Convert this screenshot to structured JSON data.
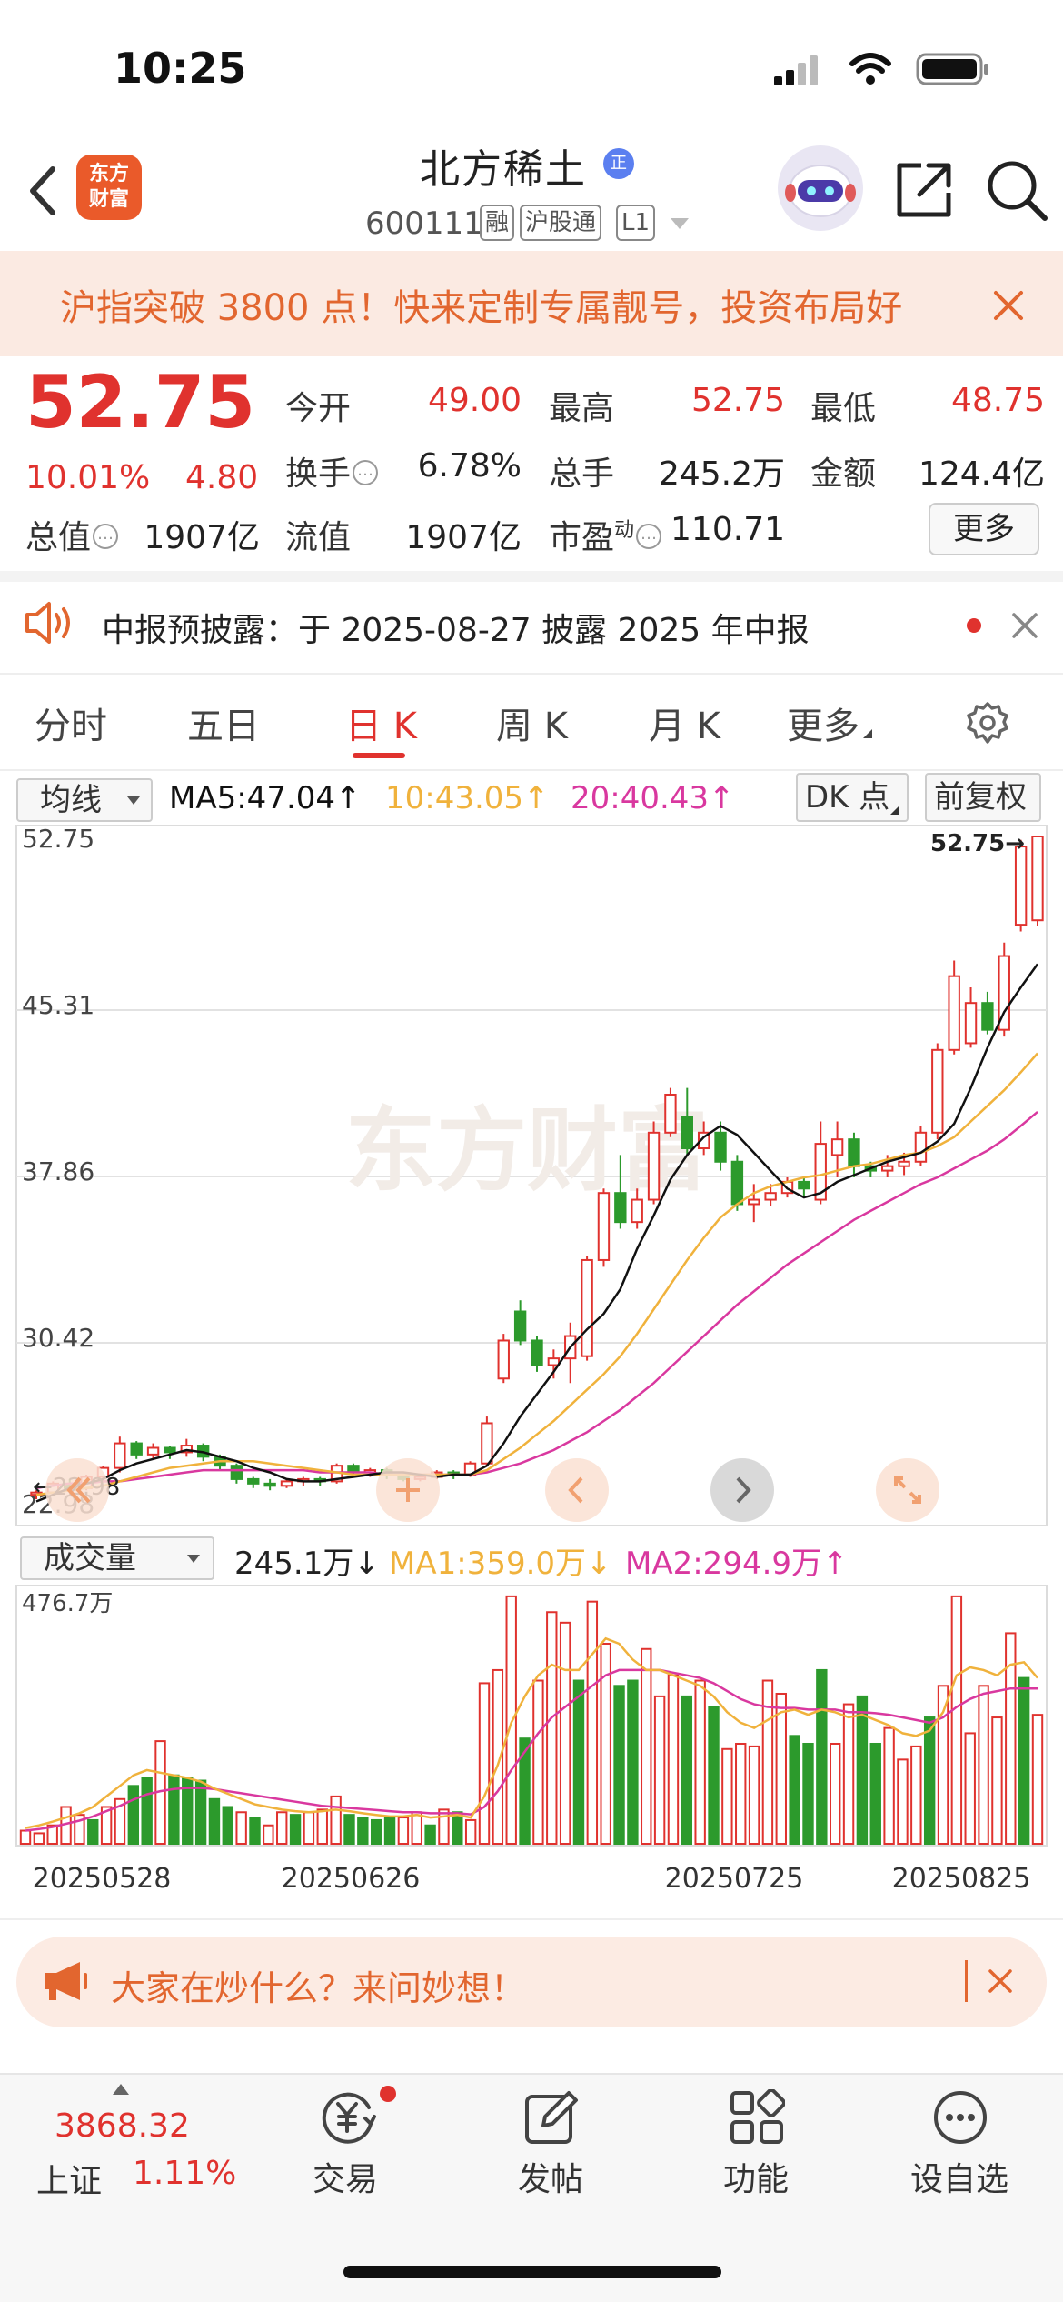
{
  "status_bar": {
    "time": "10:25"
  },
  "header": {
    "brand_logo": "东方\n财富",
    "stock_name": "北方稀土",
    "name_badge": "正",
    "stock_code": "600111",
    "tags": [
      "融",
      "沪股通",
      "L1"
    ]
  },
  "promo_banner": {
    "text": "沪指突破 3800 点！快来定制专属靓号，投资布局好"
  },
  "quote": {
    "price": "52.75",
    "change_pct": "10.01%",
    "change_amt": "4.80",
    "fields": {
      "open": {
        "label": "今开",
        "value": "49.00"
      },
      "high": {
        "label": "最高",
        "value": "52.75"
      },
      "low": {
        "label": "最低",
        "value": "48.75"
      },
      "turnover": {
        "label": "换手",
        "value": "6.78%"
      },
      "volume": {
        "label": "总手",
        "value": "245.2万"
      },
      "amount": {
        "label": "金额",
        "value": "124.4亿"
      },
      "market_cap": {
        "label": "总值",
        "value": "1907亿"
      },
      "float_cap": {
        "label": "流值",
        "value": "1907亿"
      },
      "pe": {
        "label": "市盈",
        "sup": "动",
        "value": "110.71"
      }
    },
    "more_label": "更多"
  },
  "notice": {
    "text": "中报预披露：于 2025-08-27 披露 2025 年中报"
  },
  "tabs": [
    "分时",
    "五日",
    "日 K",
    "周 K",
    "月 K",
    "更多"
  ],
  "active_tab": "日 K",
  "kline_header": {
    "indicator_select": "均线",
    "ma5": "MA5:47.04↑",
    "ma10": "10:43.05↑",
    "ma20": "20:40.43↑",
    "dk_label": "DK 点",
    "adjust_label": "前复权"
  },
  "volume_header": {
    "indicator_select": "成交量",
    "vol": "245.1万↓",
    "ma1": "MA1:359.0万↓",
    "ma2": "MA2:294.9万↑"
  },
  "watermark": "东方财富",
  "colors": {
    "up": "#e0322e",
    "down": "#2c9a2c",
    "ma5": "#111111",
    "ma10": "#f0b23c",
    "ma20": "#d9389f",
    "accent": "#e2662f"
  },
  "chart_data": [
    {
      "type": "candlestick",
      "y_ticks": [
        "52.75",
        "45.31",
        "37.86",
        "30.42",
        "22.98"
      ],
      "ylim": [
        22.98,
        52.75
      ],
      "grid": true,
      "markers": {
        "last_price_label": "52.75→",
        "low_label": "←22.98"
      },
      "series_names": [
        "MA5",
        "MA10",
        "MA20"
      ],
      "candles": [
        [
          23.3,
          23.4,
          23.1,
          23.5
        ],
        [
          23.4,
          23.8,
          23.3,
          23.9
        ],
        [
          23.8,
          23.6,
          23.5,
          24.0
        ],
        [
          23.6,
          24.1,
          23.5,
          24.2
        ],
        [
          24.1,
          24.5,
          23.9,
          24.6
        ],
        [
          24.5,
          25.6,
          24.3,
          25.9
        ],
        [
          25.6,
          25.1,
          24.9,
          25.7
        ],
        [
          25.1,
          25.4,
          24.9,
          25.6
        ],
        [
          25.4,
          25.2,
          24.9,
          25.5
        ],
        [
          25.2,
          25.5,
          25.0,
          25.8
        ],
        [
          25.5,
          25.0,
          24.8,
          25.6
        ],
        [
          25.0,
          24.6,
          24.4,
          25.1
        ],
        [
          24.6,
          24.0,
          23.8,
          24.7
        ],
        [
          24.0,
          23.8,
          23.6,
          24.1
        ],
        [
          23.8,
          23.7,
          23.5,
          24.0
        ],
        [
          23.7,
          23.9,
          23.6,
          24.0
        ],
        [
          23.9,
          24.0,
          23.7,
          24.1
        ],
        [
          24.0,
          23.9,
          23.7,
          24.1
        ],
        [
          23.9,
          24.6,
          23.8,
          24.7
        ],
        [
          24.6,
          24.3,
          24.1,
          24.7
        ],
        [
          24.3,
          24.4,
          24.1,
          24.5
        ],
        [
          24.4,
          24.2,
          24.0,
          24.5
        ],
        [
          24.2,
          24.0,
          23.9,
          24.3
        ],
        [
          24.0,
          24.1,
          23.9,
          24.2
        ],
        [
          24.1,
          24.3,
          24.0,
          24.4
        ],
        [
          24.3,
          24.2,
          24.0,
          24.4
        ],
        [
          24.2,
          24.7,
          24.1,
          24.8
        ],
        [
          24.7,
          26.5,
          24.6,
          26.8
        ],
        [
          28.5,
          30.2,
          28.3,
          30.5
        ],
        [
          31.5,
          30.2,
          30.0,
          32.0
        ],
        [
          30.2,
          29.1,
          28.8,
          30.4
        ],
        [
          29.1,
          29.4,
          28.5,
          29.8
        ],
        [
          29.4,
          30.4,
          28.3,
          31.0
        ],
        [
          29.5,
          33.8,
          29.3,
          34.0
        ],
        [
          33.8,
          36.8,
          33.5,
          37.0
        ],
        [
          36.8,
          35.5,
          35.2,
          38.5
        ],
        [
          35.5,
          36.5,
          35.2,
          37.0
        ],
        [
          36.5,
          39.5,
          36.3,
          40.0
        ],
        [
          39.5,
          41.2,
          39.3,
          41.5
        ],
        [
          40.2,
          38.8,
          38.5,
          41.5
        ],
        [
          38.8,
          39.5,
          38.5,
          40.0
        ],
        [
          39.5,
          38.2,
          37.8,
          40.0
        ],
        [
          38.2,
          36.3,
          36.0,
          38.5
        ],
        [
          36.3,
          36.5,
          35.5,
          37.2
        ],
        [
          36.5,
          36.8,
          36.2,
          37.2
        ],
        [
          36.8,
          37.3,
          36.6,
          37.5
        ],
        [
          37.3,
          37.0,
          36.6,
          37.5
        ],
        [
          36.5,
          39.0,
          36.3,
          40.0
        ],
        [
          38.5,
          39.2,
          37.5,
          40.0
        ],
        [
          39.2,
          38.0,
          37.5,
          39.5
        ],
        [
          38.0,
          37.8,
          37.5,
          38.2
        ],
        [
          37.8,
          38.0,
          37.5,
          38.5
        ],
        [
          38.0,
          38.2,
          37.6,
          38.6
        ],
        [
          38.2,
          39.5,
          38.0,
          39.8
        ],
        [
          39.5,
          43.2,
          39.2,
          43.5
        ],
        [
          43.2,
          46.5,
          43.0,
          47.2
        ],
        [
          43.5,
          45.3,
          43.3,
          46.0
        ],
        [
          45.3,
          44.1,
          43.9,
          45.8
        ],
        [
          44.1,
          47.4,
          43.8,
          48.0
        ],
        [
          48.8,
          52.3,
          48.5,
          52.6
        ],
        [
          49.0,
          52.75,
          48.75,
          52.75
        ]
      ],
      "ma5": [
        23.0,
        23.3,
        23.6,
        23.8,
        24.0,
        24.4,
        24.7,
        24.9,
        25.1,
        25.3,
        25.2,
        25.0,
        24.8,
        24.5,
        24.3,
        24.0,
        23.9,
        23.9,
        24.0,
        24.1,
        24.2,
        24.3,
        24.3,
        24.2,
        24.1,
        24.2,
        24.2,
        24.6,
        25.6,
        26.8,
        27.8,
        28.8,
        29.9,
        30.7,
        31.4,
        32.5,
        34.3,
        35.8,
        37.4,
        38.5,
        39.3,
        39.8,
        39.4,
        38.6,
        37.8,
        37.0,
        36.6,
        36.8,
        37.3,
        37.6,
        37.9,
        38.2,
        38.4,
        38.6,
        39.1,
        39.9,
        41.5,
        43.3,
        44.9,
        46.0,
        47.04
      ],
      "ma10": [
        23.3,
        23.4,
        23.5,
        23.6,
        23.7,
        23.9,
        24.1,
        24.3,
        24.5,
        24.6,
        24.7,
        24.8,
        24.8,
        24.8,
        24.7,
        24.6,
        24.5,
        24.4,
        24.3,
        24.2,
        24.2,
        24.2,
        24.2,
        24.2,
        24.2,
        24.2,
        24.2,
        24.4,
        24.9,
        25.4,
        26.0,
        26.6,
        27.3,
        28.0,
        28.7,
        29.5,
        30.5,
        31.6,
        32.7,
        33.8,
        34.8,
        35.7,
        36.3,
        36.8,
        37.1,
        37.3,
        37.5,
        37.6,
        37.8,
        38.0,
        38.1,
        38.3,
        38.5,
        38.6,
        38.9,
        39.3,
        40.0,
        40.7,
        41.4,
        42.2,
        43.05
      ],
      "ma20": [
        23.6,
        23.7,
        23.8,
        23.8,
        23.9,
        23.9,
        24.0,
        24.1,
        24.2,
        24.3,
        24.4,
        24.4,
        24.4,
        24.4,
        24.4,
        24.4,
        24.4,
        24.3,
        24.3,
        24.3,
        24.3,
        24.2,
        24.2,
        24.2,
        24.2,
        24.2,
        24.2,
        24.3,
        24.5,
        24.7,
        25.0,
        25.3,
        25.7,
        26.1,
        26.6,
        27.1,
        27.7,
        28.3,
        29.0,
        29.7,
        30.4,
        31.1,
        31.8,
        32.4,
        33.0,
        33.6,
        34.1,
        34.6,
        35.1,
        35.6,
        36.0,
        36.4,
        36.8,
        37.2,
        37.5,
        37.9,
        38.3,
        38.7,
        39.2,
        39.8,
        40.43
      ]
    },
    {
      "type": "bar",
      "y_ticks": [
        "476.7万"
      ],
      "ylim": [
        0,
        476.7
      ],
      "x_tick_labels": [
        "20250528",
        "20250626",
        "20250725",
        "20250825"
      ],
      "series_names": [
        "MA1",
        "MA2"
      ],
      "volumes": [
        25,
        20,
        35,
        70,
        55,
        45,
        70,
        85,
        110,
        125,
        195,
        130,
        125,
        120,
        85,
        70,
        60,
        50,
        35,
        60,
        55,
        60,
        65,
        90,
        55,
        50,
        45,
        50,
        50,
        60,
        35,
        65,
        60,
        45,
        305,
        330,
        470,
        200,
        310,
        440,
        420,
        310,
        460,
        380,
        300,
        310,
        370,
        280,
        320,
        280,
        310,
        260,
        180,
        190,
        185,
        310,
        285,
        205,
        190,
        330,
        190,
        265,
        280,
        190,
        220,
        160,
        185,
        240,
        300,
        470,
        210,
        300,
        240,
        400,
        315,
        245
      ],
      "directions": [
        "u",
        "u",
        "u",
        "u",
        "u",
        "d",
        "u",
        "u",
        "d",
        "d",
        "u",
        "d",
        "d",
        "d",
        "d",
        "d",
        "u",
        "d",
        "u",
        "u",
        "d",
        "u",
        "u",
        "u",
        "d",
        "d",
        "d",
        "d",
        "u",
        "u",
        "d",
        "u",
        "d",
        "u",
        "u",
        "u",
        "u",
        "d",
        "u",
        "u",
        "u",
        "d",
        "u",
        "u",
        "d",
        "d",
        "u",
        "u",
        "u",
        "d",
        "u",
        "d",
        "u",
        "u",
        "u",
        "u",
        "u",
        "d",
        "d",
        "d",
        "u",
        "u",
        "d",
        "d",
        "u",
        "u",
        "u",
        "d",
        "u",
        "u",
        "u",
        "u",
        "u",
        "u",
        "d",
        "u"
      ],
      "ma1": [
        30,
        35,
        42,
        50,
        58,
        70,
        90,
        110,
        130,
        140,
        135,
        130,
        125,
        118,
        105,
        95,
        85,
        75,
        70,
        65,
        62,
        60,
        62,
        65,
        62,
        58,
        55,
        52,
        52,
        55,
        50,
        52,
        55,
        50,
        90,
        150,
        230,
        280,
        320,
        340,
        330,
        330,
        360,
        390,
        380,
        350,
        330,
        330,
        320,
        310,
        300,
        280,
        250,
        230,
        220,
        235,
        250,
        255,
        245,
        255,
        250,
        240,
        245,
        235,
        225,
        210,
        205,
        215,
        250,
        320,
        335,
        330,
        320,
        340,
        345,
        315
      ],
      "ma2": [
        25,
        28,
        32,
        38,
        44,
        52,
        62,
        72,
        84,
        94,
        100,
        104,
        106,
        106,
        104,
        100,
        96,
        92,
        88,
        84,
        80,
        76,
        72,
        70,
        68,
        66,
        64,
        62,
        60,
        60,
        58,
        58,
        58,
        56,
        70,
        100,
        140,
        175,
        210,
        240,
        260,
        280,
        300,
        320,
        330,
        330,
        330,
        330,
        325,
        320,
        315,
        305,
        290,
        275,
        265,
        260,
        258,
        258,
        255,
        255,
        255,
        250,
        250,
        248,
        245,
        240,
        235,
        230,
        240,
        260,
        275,
        285,
        290,
        295,
        295,
        295
      ]
    }
  ],
  "ask_banner": {
    "text": "大家在炒什么？来问妙想！"
  },
  "bottom_nav": {
    "index_value": "3868.32",
    "index_name": "上证",
    "index_change": "1.11%",
    "items": [
      "交易",
      "发帖",
      "功能",
      "设自选"
    ]
  }
}
